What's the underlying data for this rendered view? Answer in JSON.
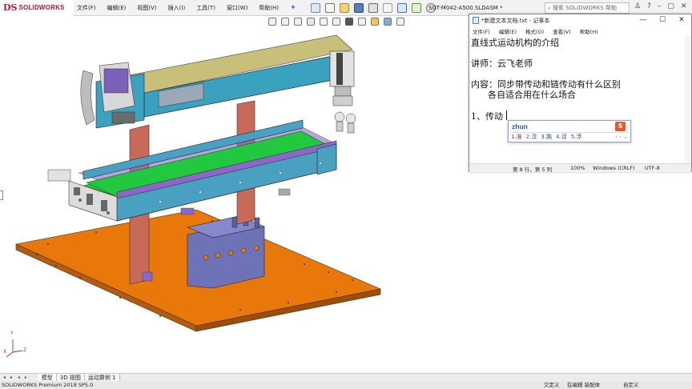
{
  "app": {
    "logo_ds": "DS",
    "logo_text": "SOLIDWORKS",
    "document_title": "SGT-M042-A500.SLDASM *",
    "search_placeholder": "搜索 SOLIDWORKS 帮助"
  },
  "menu": {
    "items": [
      "文件(F)",
      "编辑(E)",
      "视图(V)",
      "插入(I)",
      "工具(T)",
      "窗口(W)",
      "帮助(H)"
    ]
  },
  "bottom_tabs": {
    "nav_arrows": "◂ ▸ ◂ ▸",
    "tabs": [
      "模型",
      "3D 视图",
      "运动算例 1"
    ]
  },
  "status_bar": {
    "product": "SOLIDWORKS Premium 2018 SP5.0",
    "underdefined": "欠定义",
    "editing": "在编辑 装配体",
    "custom": "自定义"
  },
  "notepad": {
    "title": "*新建文本文档.txt - 记事本",
    "menu": [
      "文件(F)",
      "编辑(E)",
      "格式(O)",
      "查看(V)",
      "帮助(H)"
    ],
    "lines": [
      "直线式运动机构的介绍",
      "讲师：云飞老师",
      "内容：同步带传动和链传动有什么区别",
      "      各自适合用在什么场合",
      "1、传动"
    ],
    "status": {
      "position": "第 8 行，第 5 列",
      "zoom": "100%",
      "line_ending": "Windows (CRLF)",
      "encoding": "UTF-8"
    }
  },
  "ime": {
    "pinyin": "zhun",
    "candidates": [
      "1.准",
      "2.淳",
      "3.肫",
      "4.谆",
      "5.浮"
    ],
    "nav": "‹ › ⌄"
  },
  "triad": {
    "x": "X",
    "y": "Y",
    "z": "Z"
  },
  "colors": {
    "base_plate": "#e8780a",
    "conveyor_frame": "#4aa0c0",
    "belt": "#22c940",
    "purple_parts": "#8a67c9",
    "columns": "#c76a58",
    "guide_block": "#6e73b8",
    "beam": "#3aa1bf"
  }
}
